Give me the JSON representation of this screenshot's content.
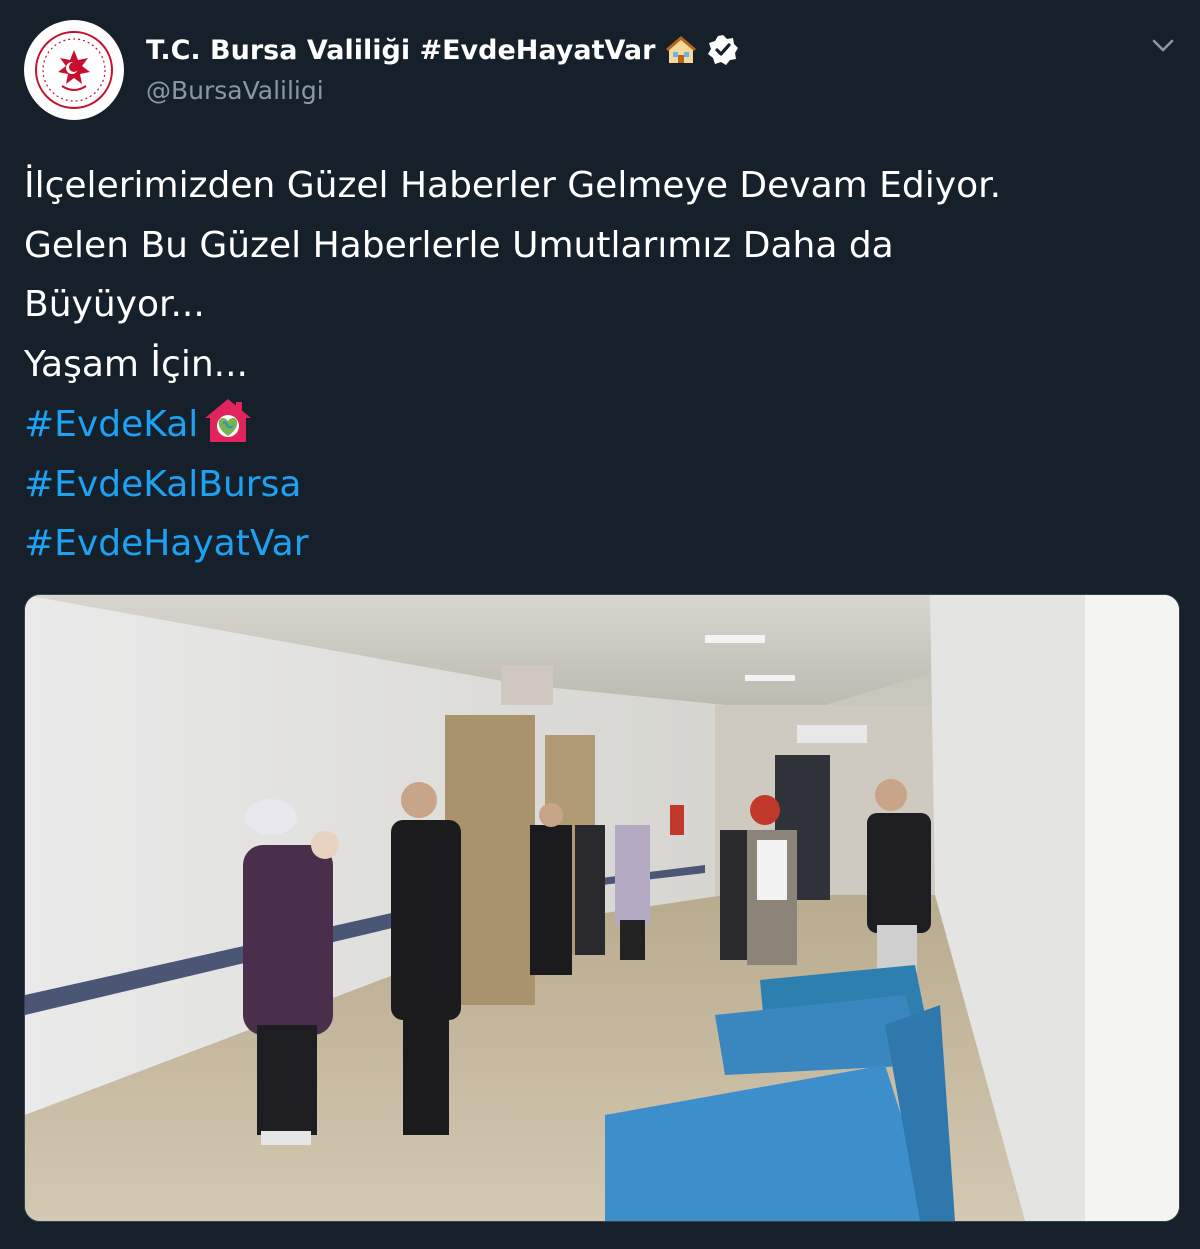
{
  "header": {
    "display_name": "T.C. Bursa Valiliği #EvdeHayatVar",
    "handle": "@BursaValiligi",
    "house_emoji": "house-emoji",
    "verified_icon": "verified-badge-icon",
    "menu_icon": "chevron-down-icon"
  },
  "tweet": {
    "lines": [
      "İlçelerimizden Güzel Haberler Gelmeye Devam Ediyor.",
      "Gelen Bu Güzel Haberlerle Umutlarımız Daha da",
      "Büyüyor...",
      "Yaşam İçin..."
    ],
    "hashtags": [
      "#EvdeKal",
      "#EvdeKalBursa",
      "#EvdeHayatVar"
    ],
    "hashtag_emoji": "house-with-heart-emoji"
  },
  "media": {
    "type": "video-still",
    "description_icon": "video-thumbnail"
  },
  "colors": {
    "background": "#15202b",
    "text": "#ffffff",
    "secondary_text": "#8899a6",
    "link": "#1da1f2",
    "avatar_accent": "#c8102e"
  }
}
